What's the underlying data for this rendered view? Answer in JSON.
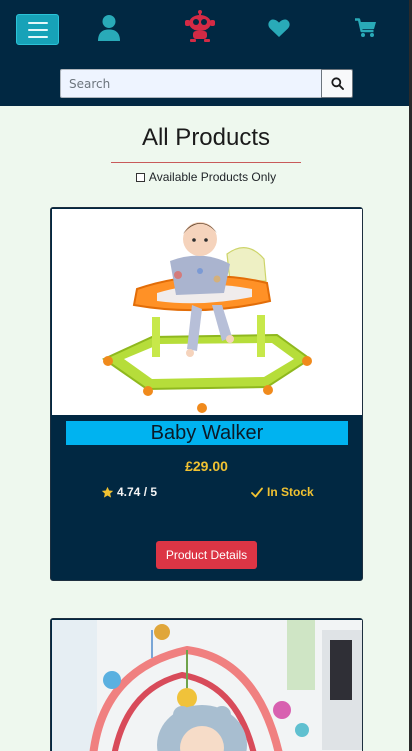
{
  "nav": {
    "menu_icon": "hamburger-icon",
    "icons": [
      "user-icon",
      "robot-logo",
      "heart-icon",
      "cart-icon"
    ],
    "colors": {
      "bar": "#012842",
      "toggle": "#17a2b8",
      "icons": "#29aab8",
      "logo": "#d42a45"
    }
  },
  "search": {
    "placeholder": "Search",
    "value": "",
    "button_icon": "search-icon"
  },
  "page": {
    "title": "All Products",
    "filter_label": "Available Products Only",
    "filter_checked": false
  },
  "products": [
    {
      "name": "Baby Walker",
      "price": "£29.00",
      "rating": "4.74 / 5",
      "stock": "In Stock",
      "button": "Product Details",
      "image": "baby-walker-photo"
    },
    {
      "image": "baby-play-gym-photo"
    }
  ],
  "colors": {
    "price": "#f1c232",
    "name_bg": "#00b3f0",
    "button": "#dc3545",
    "card": "#012842"
  }
}
